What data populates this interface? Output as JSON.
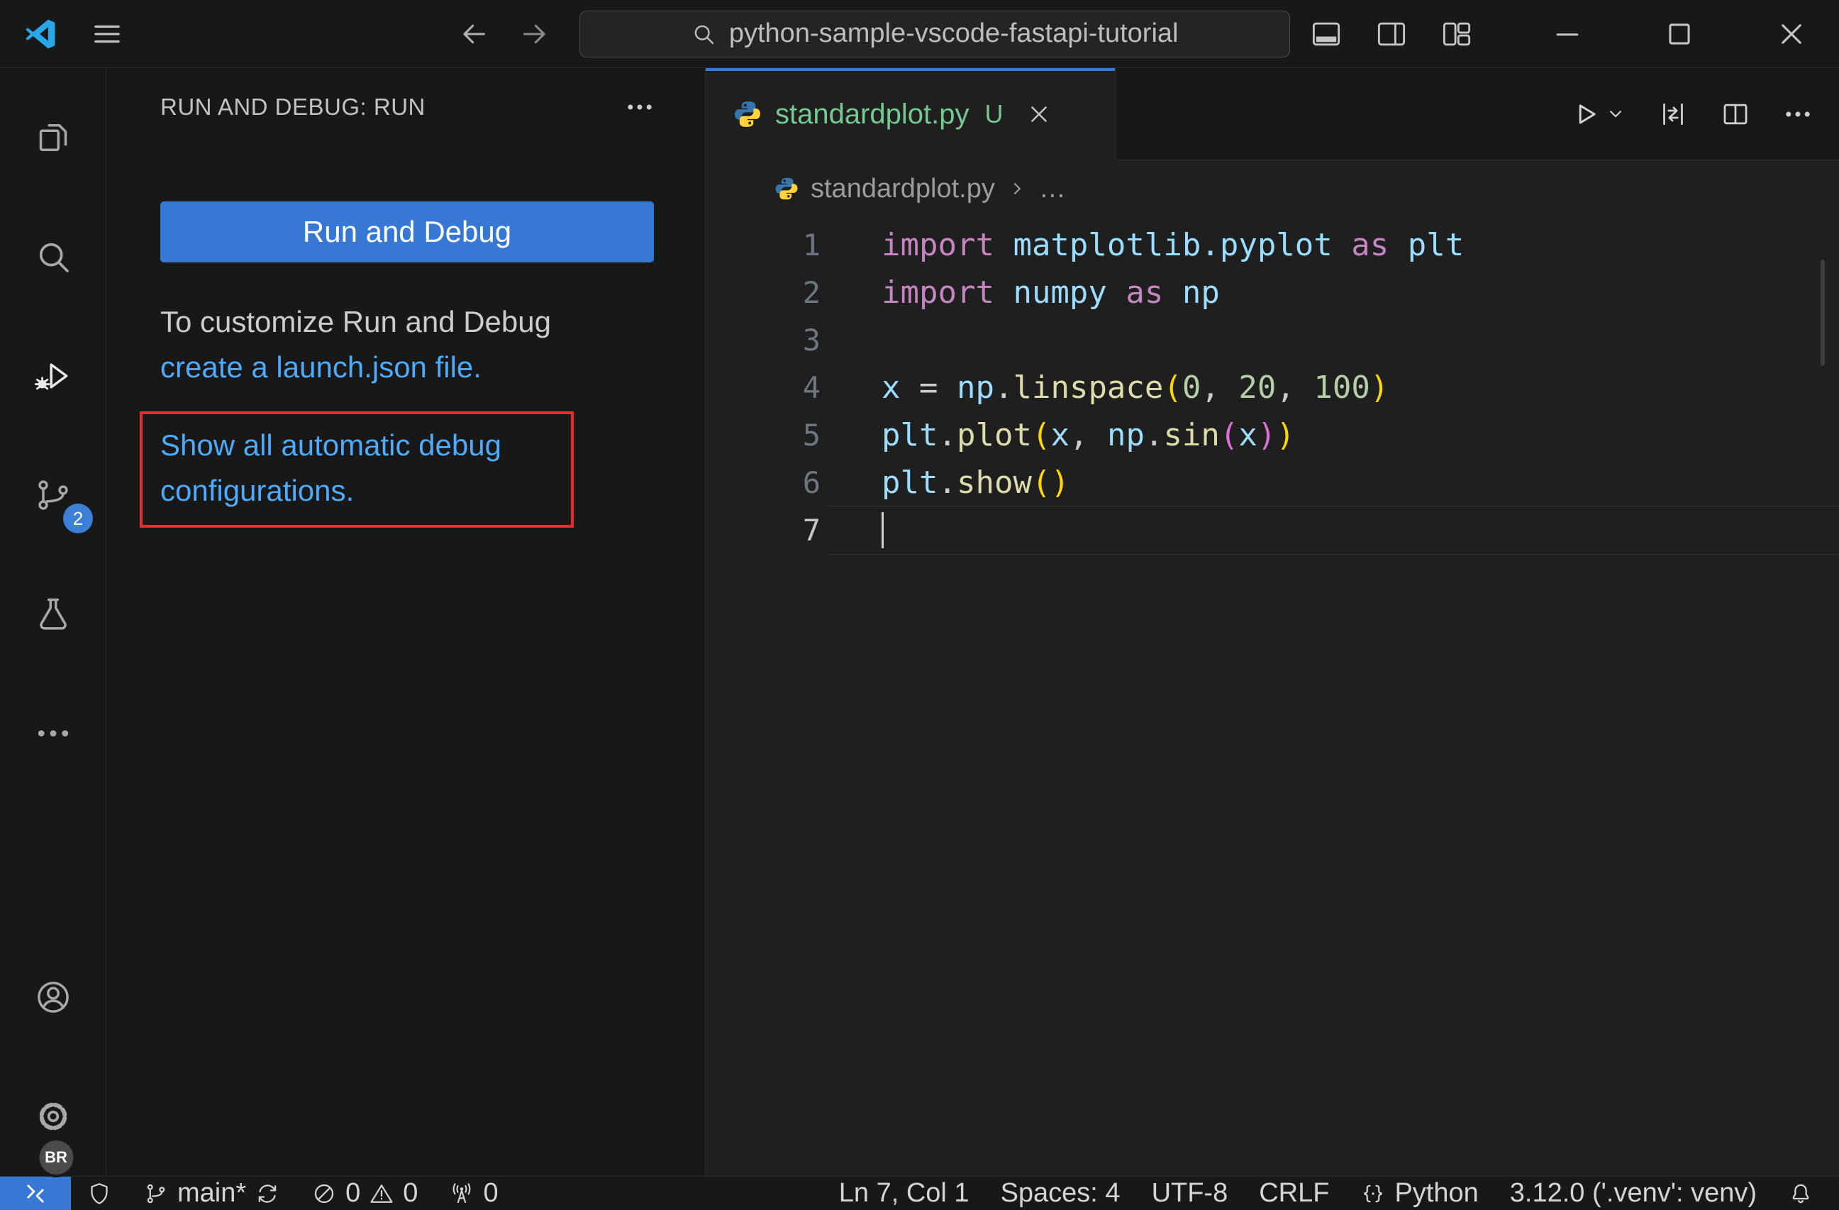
{
  "colors": {
    "accent_blue": "#3778d4",
    "link_blue": "#4daafc",
    "annotation_red": "#e62e2e",
    "untracked_green": "#73c991",
    "badge_blue": "#3b80d6",
    "syntax_keyword": "#c586c0",
    "syntax_identifier": "#9cdcfe",
    "syntax_function": "#dcdcaa",
    "syntax_number": "#b5cea8",
    "syntax_default": "#cccccc",
    "bracket_level_1": "#ffd700",
    "bracket_level_2": "#da70d6",
    "python_blue": "#3776ab",
    "python_yellow": "#ffd43b"
  },
  "titlebar": {
    "search_value": "python-sample-vscode-fastapi-tutorial"
  },
  "activity_bar": {
    "items": [
      {
        "name": "explorer",
        "icon": "files-icon",
        "active": false,
        "badge": ""
      },
      {
        "name": "search",
        "icon": "search-icon",
        "active": false,
        "badge": ""
      },
      {
        "name": "run-and-debug",
        "icon": "debug-icon",
        "active": true,
        "badge": ""
      },
      {
        "name": "source-control",
        "icon": "source-control-icon",
        "active": false,
        "badge": "2"
      },
      {
        "name": "testing",
        "icon": "beaker-icon",
        "active": false,
        "badge": ""
      },
      {
        "name": "more-views",
        "icon": "ellipsis-icon",
        "active": false,
        "badge": ""
      }
    ],
    "bottom_items": [
      {
        "name": "accounts",
        "icon": "account-icon",
        "badge": ""
      },
      {
        "name": "settings",
        "icon": "gear-icon",
        "badge": "BR"
      }
    ]
  },
  "sidebar": {
    "title": "RUN AND DEBUG: RUN",
    "run_button_label": "Run and Debug",
    "customize_text": "To customize Run and Debug",
    "customize_link": "create a launch.json file.",
    "auto_config_link": "Show all automatic debug configurations."
  },
  "editor": {
    "tab": {
      "label": "standardplot.py",
      "dirty": "U"
    },
    "breadcrumbs": [
      "standardplot.py",
      "…"
    ],
    "lines": [
      {
        "n": 1,
        "tokens": [
          [
            "import",
            "kw"
          ],
          [
            " ",
            "pl"
          ],
          [
            "matplotlib.pyplot",
            "id"
          ],
          [
            " ",
            "pl"
          ],
          [
            "as",
            "kw"
          ],
          [
            " ",
            "pl"
          ],
          [
            "plt",
            "id"
          ]
        ]
      },
      {
        "n": 2,
        "tokens": [
          [
            "import",
            "kw"
          ],
          [
            " ",
            "pl"
          ],
          [
            "numpy",
            "id"
          ],
          [
            " ",
            "pl"
          ],
          [
            "as",
            "kw"
          ],
          [
            " ",
            "pl"
          ],
          [
            "np",
            "id"
          ]
        ]
      },
      {
        "n": 3,
        "tokens": []
      },
      {
        "n": 4,
        "tokens": [
          [
            "x",
            "id"
          ],
          [
            " ",
            "pl"
          ],
          [
            "=",
            "pl"
          ],
          [
            " ",
            "pl"
          ],
          [
            "np",
            "id"
          ],
          [
            ".",
            "pl"
          ],
          [
            "linspace",
            "fn"
          ],
          [
            "(",
            "b1"
          ],
          [
            "0",
            "num"
          ],
          [
            ",",
            "pl"
          ],
          [
            " ",
            "pl"
          ],
          [
            "20",
            "num"
          ],
          [
            ",",
            "pl"
          ],
          [
            " ",
            "pl"
          ],
          [
            "100",
            "num"
          ],
          [
            ")",
            "b1"
          ]
        ]
      },
      {
        "n": 5,
        "tokens": [
          [
            "plt",
            "id"
          ],
          [
            ".",
            "pl"
          ],
          [
            "plot",
            "fn"
          ],
          [
            "(",
            "b1"
          ],
          [
            "x",
            "id"
          ],
          [
            ",",
            "pl"
          ],
          [
            " ",
            "pl"
          ],
          [
            "np",
            "id"
          ],
          [
            ".",
            "pl"
          ],
          [
            "sin",
            "fn"
          ],
          [
            "(",
            "b2"
          ],
          [
            "x",
            "id"
          ],
          [
            ")",
            "b2"
          ],
          [
            ")",
            "b1"
          ]
        ]
      },
      {
        "n": 6,
        "tokens": [
          [
            "plt",
            "id"
          ],
          [
            ".",
            "pl"
          ],
          [
            "show",
            "fn"
          ],
          [
            "(",
            "b1"
          ],
          [
            ")",
            "b1"
          ]
        ]
      },
      {
        "n": 7,
        "tokens": [],
        "current": true
      }
    ]
  },
  "status_bar": {
    "left": [
      {
        "name": "remote",
        "icon": "remote-icon",
        "style": "remote"
      },
      {
        "name": "workspace-trust",
        "icon": "shield-icon"
      },
      {
        "name": "git-branch",
        "icon": "branch-icon",
        "text": "main*",
        "icon2": "sync-icon"
      },
      {
        "name": "problems",
        "icon": "error-icon",
        "text": "0",
        "icon2": "warning-icon",
        "text2": "0"
      },
      {
        "name": "ports",
        "icon": "radio-tower-icon",
        "text": "0"
      }
    ],
    "right": [
      {
        "name": "cursor-position",
        "text": "Ln 7, Col 1"
      },
      {
        "name": "indentation",
        "text": "Spaces: 4"
      },
      {
        "name": "encoding",
        "text": "UTF-8"
      },
      {
        "name": "eol",
        "text": "CRLF"
      },
      {
        "name": "language-mode",
        "icon": "braces-icon",
        "text": "Python"
      },
      {
        "name": "python-interpreter",
        "text": "3.12.0 ('.venv': venv)"
      },
      {
        "name": "notifications",
        "icon": "bell-icon"
      }
    ]
  }
}
